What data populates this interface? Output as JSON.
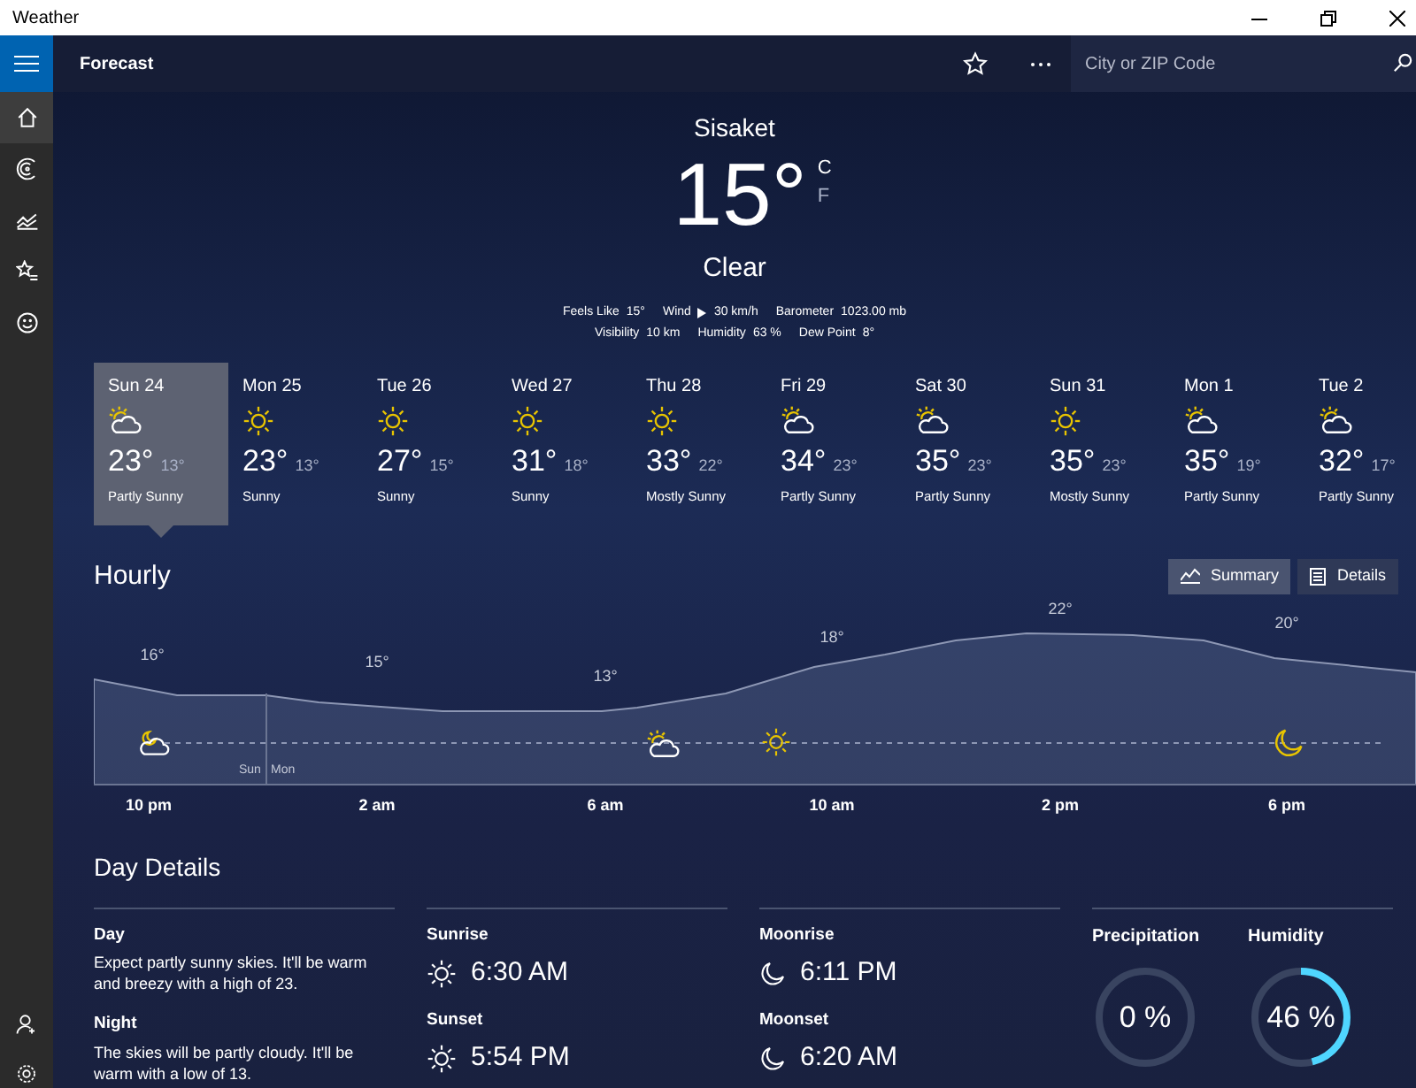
{
  "window": {
    "title": "Weather"
  },
  "header": {
    "title": "Forecast",
    "search": {
      "placeholder": "City or ZIP Code"
    }
  },
  "sidebar": {
    "items": [
      {
        "kind": "home",
        "selected": true
      },
      {
        "kind": "maps",
        "selected": false
      },
      {
        "kind": "historical",
        "selected": false
      },
      {
        "kind": "places",
        "selected": false
      },
      {
        "kind": "news",
        "selected": false
      }
    ]
  },
  "current": {
    "city": "Sisaket",
    "temperature": "15°",
    "units": [
      {
        "label": "C",
        "selected": true
      },
      {
        "label": "F",
        "selected": false
      }
    ],
    "condition": "Clear",
    "details": [
      [
        {
          "label": "Feels Like",
          "value": "15°"
        },
        {
          "label": "Wind",
          "value": "30 km/h"
        },
        {
          "label": "Barometer",
          "value": "1023.00 mb"
        }
      ],
      [
        {
          "label": "Visibility",
          "value": "10 km"
        },
        {
          "label": "Humidity",
          "value": "63 %"
        },
        {
          "label": "Dew Point",
          "value": "8°"
        }
      ]
    ]
  },
  "forecast": [
    {
      "day": "Sun 24",
      "kind": "partly",
      "high": "23°",
      "low": "13°",
      "condition": "Partly Sunny",
      "selected": true
    },
    {
      "day": "Mon 25",
      "kind": "sunny",
      "high": "23°",
      "low": "13°",
      "condition": "Sunny",
      "selected": false
    },
    {
      "day": "Tue 26",
      "kind": "sunny",
      "high": "27°",
      "low": "15°",
      "condition": "Sunny",
      "selected": false
    },
    {
      "day": "Wed 27",
      "kind": "sunny",
      "high": "31°",
      "low": "18°",
      "condition": "Sunny",
      "selected": false
    },
    {
      "day": "Thu 28",
      "kind": "sunny",
      "high": "33°",
      "low": "22°",
      "condition": "Mostly Sunny",
      "selected": false
    },
    {
      "day": "Fri 29",
      "kind": "partly",
      "high": "34°",
      "low": "23°",
      "condition": "Partly Sunny",
      "selected": false
    },
    {
      "day": "Sat 30",
      "kind": "partly",
      "high": "35°",
      "low": "23°",
      "condition": "Partly Sunny",
      "selected": false
    },
    {
      "day": "Sun 31",
      "kind": "sunny",
      "high": "35°",
      "low": "23°",
      "condition": "Mostly Sunny",
      "selected": false
    },
    {
      "day": "Mon 1",
      "kind": "partly",
      "high": "35°",
      "low": "19°",
      "condition": "Partly Sunny",
      "selected": false
    },
    {
      "day": "Tue 2",
      "kind": "partly",
      "high": "32°",
      "low": "17°",
      "condition": "Partly Sunny",
      "selected": false
    }
  ],
  "hourly": {
    "title": "Hourly",
    "views": [
      {
        "label": "Summary",
        "kind": "summary",
        "selected": true
      },
      {
        "label": "Details",
        "kind": "details",
        "selected": false
      }
    ],
    "temps": [
      "16°",
      "15°",
      "13°",
      "18°",
      "22°",
      "20°"
    ],
    "day_labels": [
      "Sun",
      "Mon"
    ],
    "times": [
      "10 pm",
      "2 am",
      "6 am",
      "10 am",
      "2 pm",
      "6 pm"
    ]
  },
  "day_details": {
    "title": "Day Details",
    "summary": [
      {
        "label": "Day",
        "text": "Expect partly sunny skies. It'll be warm and breezy with a high of 23."
      },
      {
        "label": "Night",
        "text": "The skies will be partly cloudy. It'll be warm with a low of 13."
      }
    ],
    "sun": [
      {
        "label": "Sunrise",
        "time": "6:30 AM"
      },
      {
        "label": "Sunset",
        "time": "5:54 PM"
      }
    ],
    "moon": [
      {
        "label": "Moonrise",
        "time": "6:11 PM"
      },
      {
        "label": "Moonset",
        "time": "6:20 AM"
      }
    ],
    "gauges": [
      {
        "label": "Precipitation",
        "reading": "0 %",
        "level": 0
      },
      {
        "label": "Humidity",
        "reading": "46 %",
        "level": 0.46
      }
    ]
  }
}
